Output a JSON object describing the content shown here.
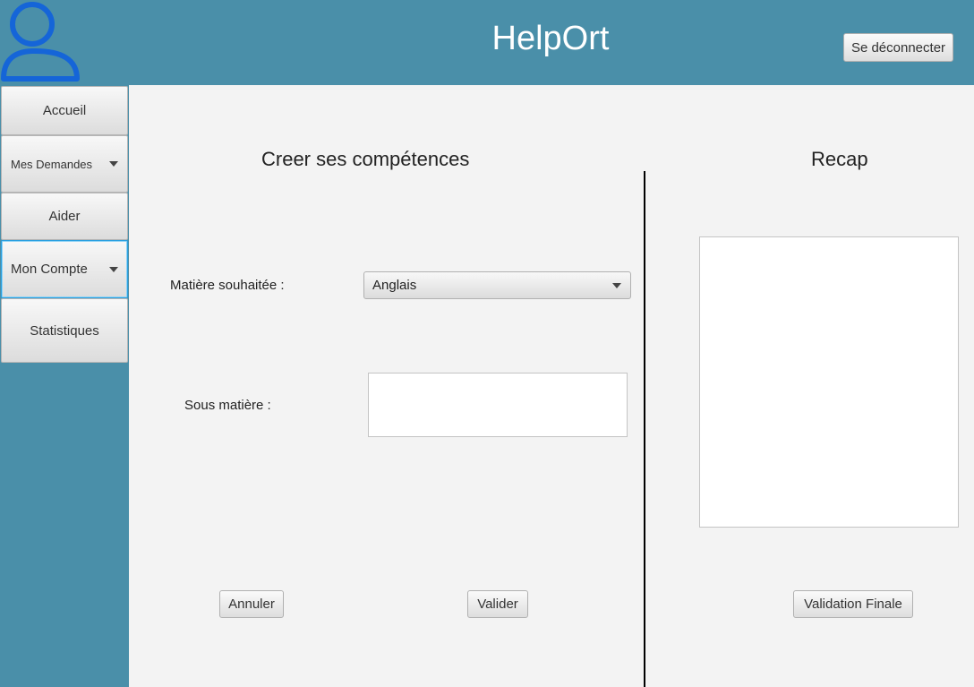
{
  "header": {
    "title": "HelpOrt",
    "logout_label": "Se déconnecter",
    "avatar_icon": "user-icon",
    "avatar_color": "#1565d8",
    "background": "#4a8fa9"
  },
  "sidebar": {
    "items": [
      {
        "label": "Accueil",
        "type": "button"
      },
      {
        "label": "Mes Demandes",
        "type": "menu"
      },
      {
        "label": "Aider",
        "type": "button"
      },
      {
        "label": "Mon Compte",
        "type": "menu",
        "focused": true
      },
      {
        "label": "Statistiques",
        "type": "button"
      }
    ]
  },
  "form": {
    "title": "Creer ses compétences",
    "subject_label": "Matière souhaitée :",
    "subject_value": "Anglais",
    "sub_subject_label": "Sous matière :",
    "sub_subject_value": "",
    "cancel_label": "Annuler",
    "validate_label": "Valider"
  },
  "recap": {
    "title": "Recap",
    "content": "",
    "final_validation_label": "Validation Finale"
  }
}
